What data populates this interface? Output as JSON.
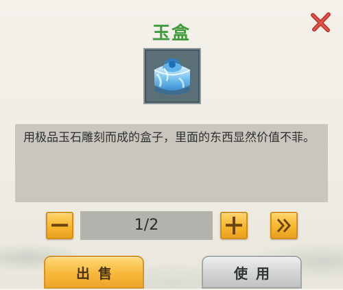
{
  "dialog": {
    "title": "玉盒",
    "close_icon": "close-icon",
    "item_icon": "jade-box-icon",
    "description": "用极品玉石雕刻而成的盒子，里面的东西显然价值不菲。",
    "quantity": {
      "text": "1/2",
      "decrease_icon": "minus-icon",
      "increase_icon": "plus-icon",
      "max_icon": "double-chevron-right-icon"
    },
    "buttons": {
      "sell_label": "出售",
      "use_label": "使用"
    },
    "colors": {
      "title": "#3f9a3c",
      "close": "#d2403a",
      "accent_button": "#f7b62d",
      "secondary_button": "#cfd2d1"
    }
  }
}
